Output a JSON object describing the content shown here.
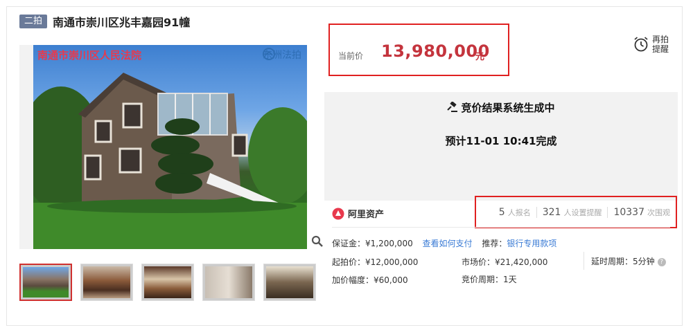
{
  "header": {
    "round_badge": "二拍",
    "title": "南通市崇川区兆丰嘉园91幢"
  },
  "photo": {
    "court_label": "南通市崇川区人民法院",
    "watermark": "东洲法拍"
  },
  "price": {
    "label": "当前价",
    "value": "13,980,000",
    "unit": "元"
  },
  "remind": {
    "label": "再拍提醒"
  },
  "status": {
    "line1": "竞价结果系统生成中",
    "line2": "预计11-01 10:41完成"
  },
  "brand": {
    "name": "阿里资产"
  },
  "stats": [
    {
      "num": "5",
      "label": "人报名"
    },
    {
      "num": "321",
      "label": "人设置提醒"
    },
    {
      "num": "10337",
      "label": "次围观"
    }
  ],
  "info": {
    "deposit": "保证金：¥1,200,000",
    "deposit_link": "查看如何支付",
    "recommend": "推荐：",
    "recommend_link": "银行专用款项",
    "start_price": "起拍价：¥12,000,000",
    "market_price": "市场价：¥21,420,000",
    "delay": "延时周期：5分钟",
    "increment": "加价幅度：¥60,000",
    "bid_period": "竞价周期：1天"
  },
  "colors": {
    "price_red": "#c4343d",
    "highlight_border": "#e02020",
    "link_blue": "#3a7bd5",
    "badge_bg": "#6a7a99"
  }
}
